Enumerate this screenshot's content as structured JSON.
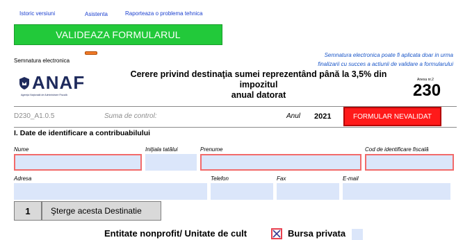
{
  "top_links": [
    "Istoric versiuni",
    "Asistenta",
    "Raporteaza o problema tehnica"
  ],
  "validate_button": "VALIDEAZA FORMULARUL",
  "signature": {
    "label": "Semnatura electronica",
    "note_line1": "Semnatura electronica poate fi aplicata doar in urma",
    "note_line2": "finalizarii cu succes a actiunii de validare a formularului"
  },
  "logo": {
    "name": "ANAF",
    "subtitle": "Agenţia Naţională de Administrare Fiscală"
  },
  "form": {
    "title_line1": "Cerere privind destinaţia sumei reprezentând până la 3,5%  din impozitul",
    "title_line2": "anual datorat",
    "anexa_label": "Anexa nr.2",
    "number": "230"
  },
  "meta": {
    "code": "D230_A1.0.5",
    "control_sum_label": "Suma de control:",
    "year_label": "Anul",
    "year": "2021",
    "status_button": "FORMULAR NEVALIDAT"
  },
  "section": {
    "title": "I. Date de identificare a contribuabilului",
    "fields": {
      "nume": "Nume",
      "initiala": "Iniţiala tatălui",
      "prenume": "Prenume",
      "cif": "Cod de identificare fiscală",
      "adresa": "Adresa",
      "telefon": "Telefon",
      "fax": "Fax",
      "email": "E-mail"
    },
    "values": {
      "nume": "",
      "initiala": "",
      "prenume": "",
      "cif": "",
      "adresa": "",
      "telefon": "",
      "fax": "",
      "email": ""
    }
  },
  "destinatie": {
    "number": "1",
    "delete_button": "Şterge acesta Destinatie",
    "entitate_label": "Entitate nonprofit/ Unitate de cult",
    "entitate_checked": true,
    "bursa_label": "Bursa privata",
    "bursa_checked": false
  },
  "colors": {
    "link": "#1a3fcf",
    "validate_green": "#22c93a",
    "invalid_red": "#ff1a1a",
    "field_bg": "#dbe6fa",
    "required_border": "#f26a6a",
    "note_blue": "#1a56c8",
    "anaf_navy": "#1e2a5c"
  }
}
